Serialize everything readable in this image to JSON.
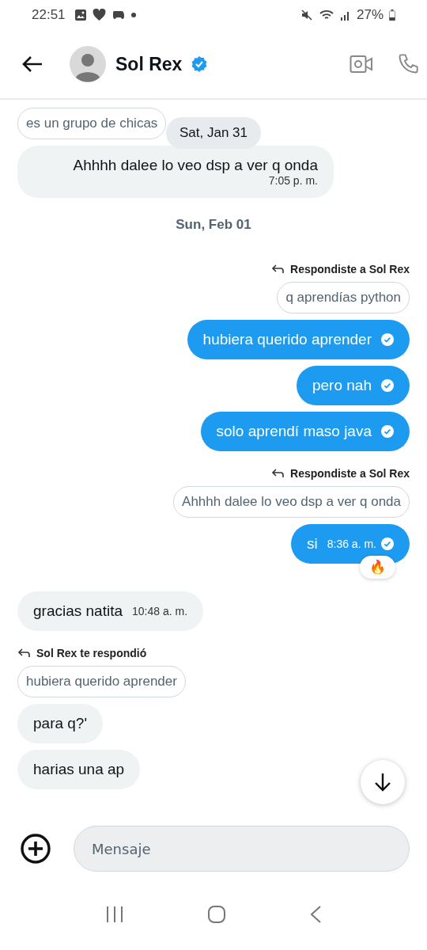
{
  "status_bar": {
    "time": "22:51",
    "battery": "27%"
  },
  "header": {
    "name": "Sol Rex",
    "verified": true
  },
  "floating_date": "Sat, Jan 31",
  "messages": [
    {
      "kind": "quote",
      "outgoing": false,
      "text": "es un grupo de chicas"
    },
    {
      "kind": "bubble",
      "outgoing": false,
      "text": "Ahhhh dalee lo veo dsp a ver q onda",
      "time": "7:05 p. m.",
      "read": false
    },
    {
      "kind": "date",
      "text": "Sun, Feb 01"
    },
    {
      "kind": "reply",
      "outgoing": true,
      "text": "Respondiste a Sol Rex"
    },
    {
      "kind": "quote",
      "outgoing": true,
      "text": "q aprendías python"
    },
    {
      "kind": "bubble",
      "outgoing": true,
      "text": "hubiera querido aprender",
      "read": true
    },
    {
      "kind": "bubble",
      "outgoing": true,
      "text": "pero nah",
      "read": true
    },
    {
      "kind": "bubble",
      "outgoing": true,
      "text": "solo aprendí maso java",
      "read": true
    },
    {
      "kind": "reply",
      "outgoing": true,
      "text": "Respondiste a Sol Rex"
    },
    {
      "kind": "quote",
      "outgoing": true,
      "text": "Ahhhh dalee lo veo dsp a ver q onda"
    },
    {
      "kind": "bubble",
      "outgoing": true,
      "text": "si",
      "time": "8:36 a. m.",
      "read": true,
      "reaction": "🔥"
    },
    {
      "kind": "bubble",
      "outgoing": false,
      "text": "gracias natita",
      "time": "10:48 a. m.",
      "read": false
    },
    {
      "kind": "reply",
      "outgoing": false,
      "text": "Sol Rex te respondió"
    },
    {
      "kind": "quote",
      "outgoing": false,
      "text": "hubiera querido aprender"
    },
    {
      "kind": "bubble",
      "outgoing": false,
      "text": "para q?'",
      "read": false
    },
    {
      "kind": "bubble",
      "outgoing": false,
      "text": "harias una ap",
      "read": false
    }
  ],
  "composer": {
    "placeholder": "Mensaje"
  }
}
